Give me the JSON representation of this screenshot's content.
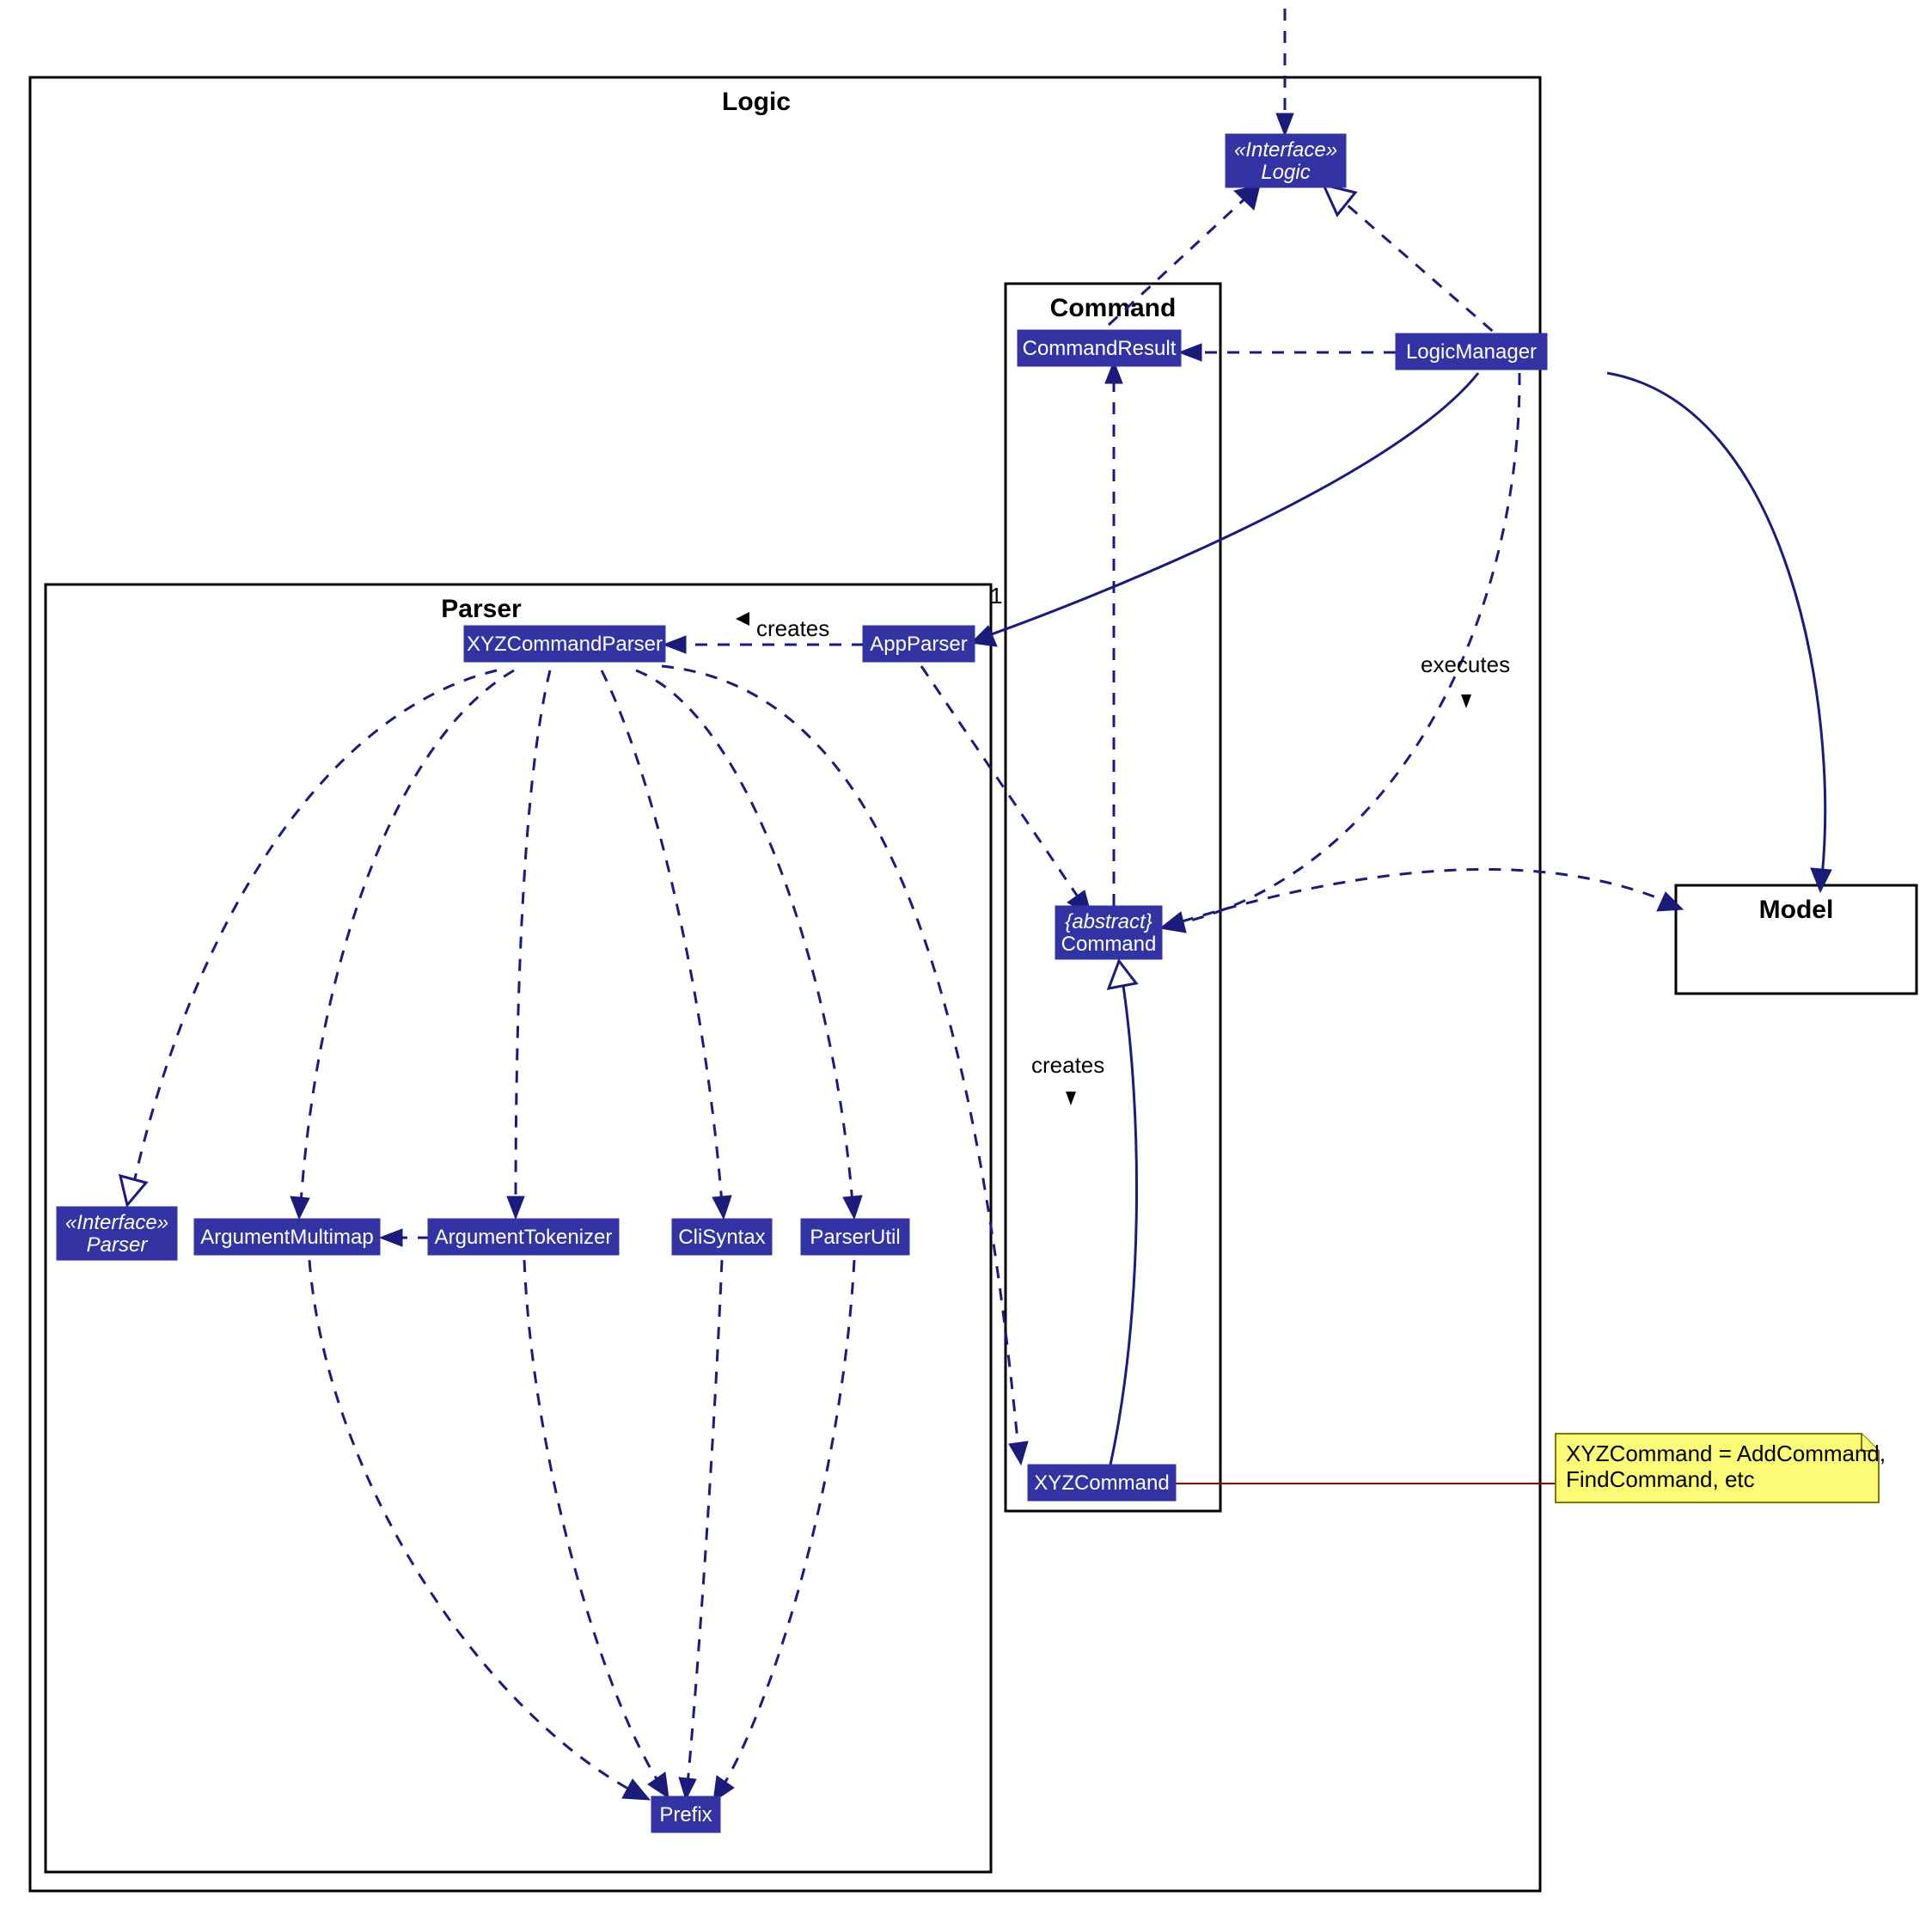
{
  "packages": {
    "logic": "Logic",
    "parser": "Parser",
    "command": "Command",
    "model": "Model"
  },
  "classes": {
    "logic_interface_stereo": "«Interface»",
    "logic_interface_name": "Logic",
    "command_result": "CommandResult",
    "logic_manager": "LogicManager",
    "app_parser": "AppParser",
    "xyz_command_parser": "XYZCommandParser",
    "abstract_stereo": "{abstract}",
    "command_name": "Command",
    "parser_interface_stereo": "«Interface»",
    "parser_interface_name": "Parser",
    "argument_multimap": "ArgumentMultimap",
    "argument_tokenizer": "ArgumentTokenizer",
    "cli_syntax": "CliSyntax",
    "parser_util": "ParserUtil",
    "xyz_command": "XYZCommand",
    "prefix": "Prefix"
  },
  "labels": {
    "creates_parser": "creates",
    "executes": "executes",
    "creates_command": "creates",
    "multiplicity_1": "1"
  },
  "note": {
    "line1": "XYZCommand = AddCommand,",
    "line2": "FindCommand, etc"
  }
}
